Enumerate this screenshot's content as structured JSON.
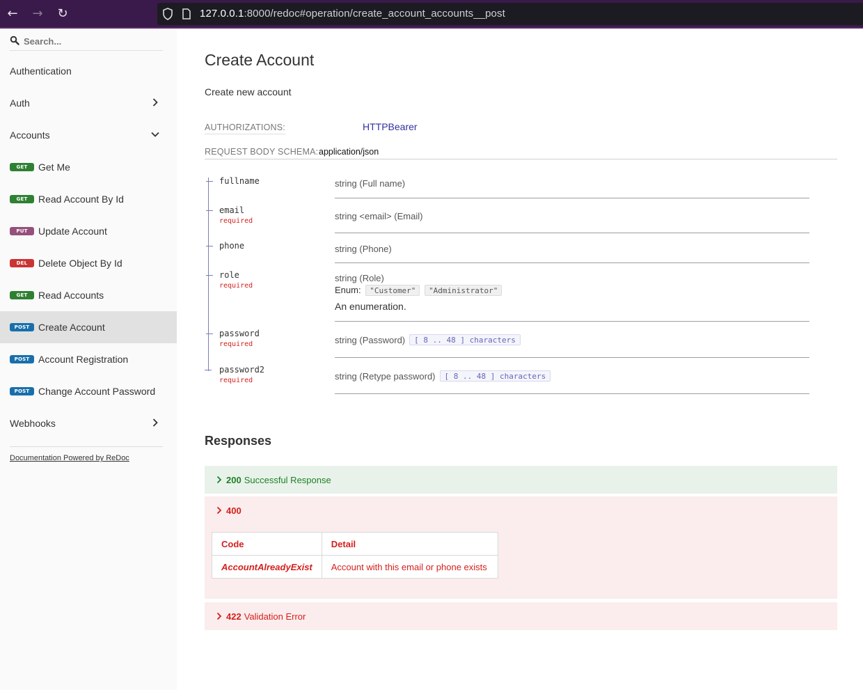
{
  "browser": {
    "url_host": "127.0.0.1",
    "url_rest": ":8000/redoc#operation/create_account_accounts__post",
    "back_icon": "arrow-left-icon",
    "forward_icon": "arrow-right-icon",
    "reload_icon": "reload-icon"
  },
  "sidebar": {
    "search_placeholder": "Search...",
    "items": [
      {
        "label": "Authentication"
      },
      {
        "label": "Auth"
      },
      {
        "label": "Accounts"
      },
      {
        "method": "GET",
        "label": "Get Me"
      },
      {
        "method": "GET",
        "label": "Read Account By Id"
      },
      {
        "method": "PUT",
        "label": "Update Account"
      },
      {
        "method": "DEL",
        "label": "Delete Object By Id"
      },
      {
        "method": "GET",
        "label": "Read Accounts"
      },
      {
        "method": "POST",
        "label": "Create Account"
      },
      {
        "method": "POST",
        "label": "Account Registration"
      },
      {
        "method": "POST",
        "label": "Change Account Password"
      },
      {
        "label": "Webhooks"
      }
    ],
    "powered_by": "Documentation Powered by ReDoc"
  },
  "main": {
    "title": "Create Account",
    "description": "Create new account",
    "authorizations_label": "AUTHORIZATIONS:",
    "authorizations_value": "HTTPBearer",
    "request_body_label": "REQUEST BODY SCHEMA:",
    "request_body_type": "application/json",
    "required_label": "required",
    "fields": [
      {
        "name": "fullname",
        "type": "string (Full name)"
      },
      {
        "name": "email",
        "type": "string <email> (Email)"
      },
      {
        "name": "phone",
        "type": "string (Phone)"
      },
      {
        "name": "role",
        "type": "string (Role)",
        "enum_label": "Enum:",
        "enum": [
          "\"Customer\"",
          "\"Administrator\""
        ],
        "note": "An enumeration."
      },
      {
        "name": "password",
        "type": "string (Password)",
        "constraint": "[ 8 .. 48 ] characters"
      },
      {
        "name": "password2",
        "type": "string (Retype password)",
        "constraint": "[ 8 .. 48 ] characters"
      }
    ],
    "responses_title": "Responses",
    "responses": [
      {
        "code": "200",
        "label": "Successful Response"
      },
      {
        "code": "400",
        "label": ""
      },
      {
        "code": "422",
        "label": "Validation Error"
      }
    ],
    "error_table": {
      "headers": [
        "Code",
        "Detail"
      ],
      "rows": [
        [
          "AccountAlreadyExist",
          "Account with this email or phone exists"
        ]
      ]
    }
  },
  "colors": {
    "sidebar_bg": "#fafafa",
    "active_item_bg": "#e1e1e1",
    "get": "#2f8132",
    "put": "#95507c",
    "delete": "#cc3333",
    "post": "#186fab",
    "success": "#1d8127",
    "error": "#d41f1c",
    "link": "#32329f"
  }
}
